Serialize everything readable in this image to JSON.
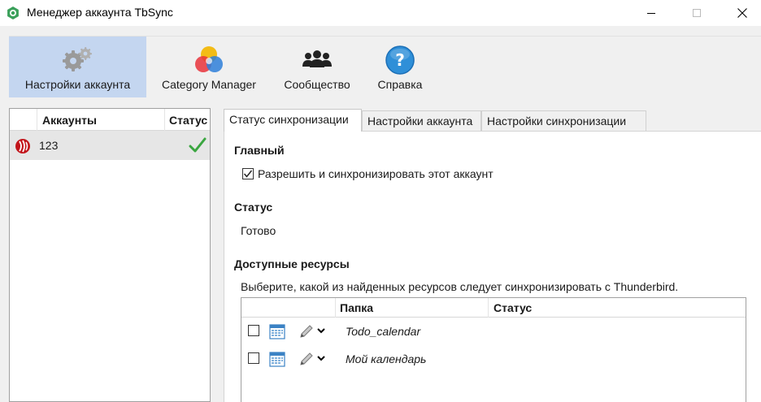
{
  "window": {
    "title": "Менеджер аккаунта TbSync"
  },
  "toolbar": {
    "items": [
      {
        "label": "Настройки аккаунта",
        "icon": "gears-icon",
        "active": true
      },
      {
        "label": "Category Manager",
        "icon": "color-circles-icon",
        "active": false
      },
      {
        "label": "Сообщество",
        "icon": "people-icon",
        "active": false
      },
      {
        "label": "Справка",
        "icon": "help-icon",
        "active": false
      }
    ]
  },
  "accounts": {
    "header": {
      "name": "Аккаунты",
      "status": "Статус"
    },
    "rows": [
      {
        "name": "123",
        "status_icon": "check-icon",
        "account_icon": "provider-icon"
      }
    ]
  },
  "tabs": [
    {
      "label": "Статус синхронизации",
      "active": true
    },
    {
      "label": "Настройки аккаунта",
      "active": false
    },
    {
      "label": "Настройки синхронизации",
      "active": false
    }
  ],
  "main": {
    "section_main": "Главный",
    "enable_label": "Разрешить и синхронизировать этот аккаунт",
    "enable_checked": true,
    "section_status": "Статус",
    "status_value": "Готово",
    "section_resources": "Доступные ресурсы",
    "resources_hint": "Выберите, какой из найденных ресурсов следует синхронизировать с Thunderbird.",
    "table": {
      "headers": {
        "folder": "Папка",
        "status": "Статус"
      },
      "rows": [
        {
          "name": "Todo_calendar",
          "checked": false,
          "status": ""
        },
        {
          "name": "Мой календарь",
          "checked": false,
          "status": ""
        }
      ]
    }
  },
  "colors": {
    "toolbar_active": "#c4d6f0",
    "check_green": "#3aa640",
    "help_blue": "#2f8fd8"
  }
}
